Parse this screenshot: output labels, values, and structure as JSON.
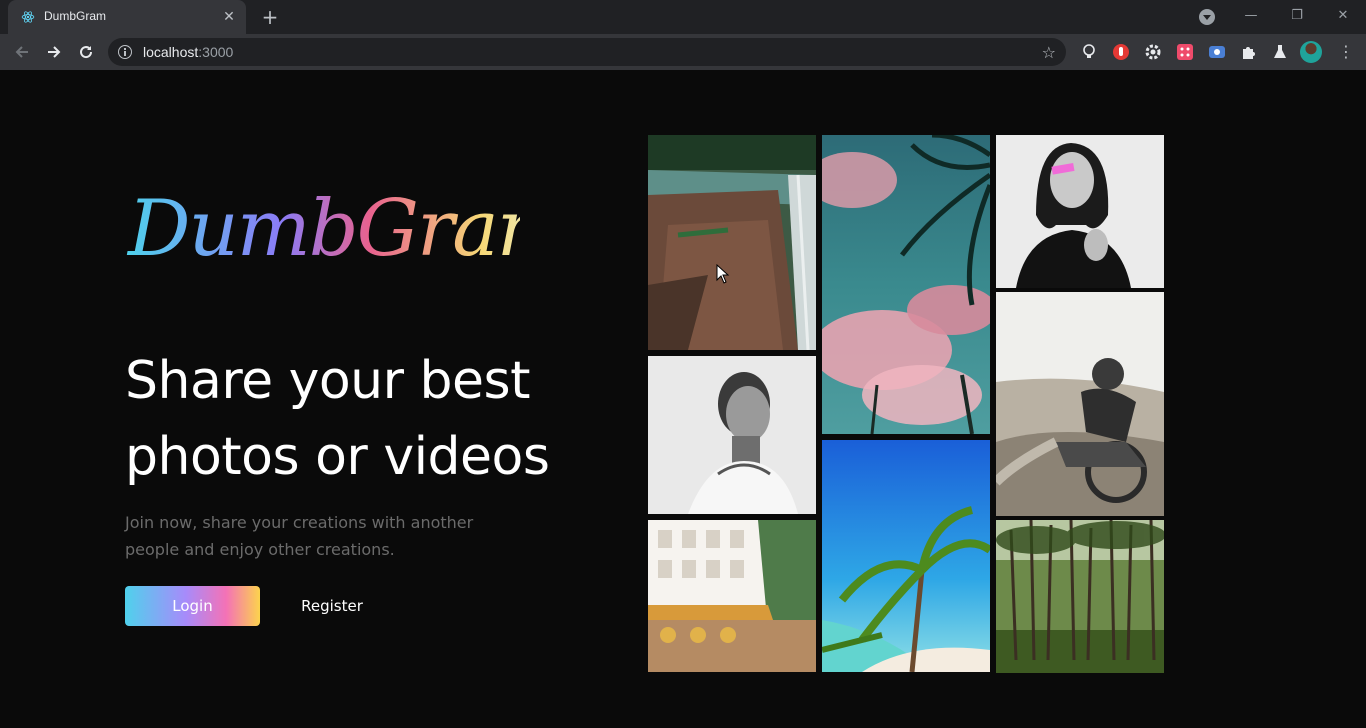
{
  "browser": {
    "tab_title": "DumbGram",
    "tab_close": "✕",
    "new_tab": "+",
    "url_host": "localhost",
    "url_port": ":3000",
    "window_minimize": "—",
    "window_restore": "❐",
    "window_close": "✕"
  },
  "hero": {
    "logo_text": "DumbGram",
    "headline_line1": "Share your best",
    "headline_line2": "photos or videos",
    "subtext": "Join now, share your creations with another people and enjoy other creations.",
    "login_label": "Login",
    "register_label": "Register"
  },
  "gallery": {
    "photos": [
      {
        "name": "waterfall-cliff-photo"
      },
      {
        "name": "palm-trees-pink-sky-photo"
      },
      {
        "name": "woman-black-white-photo"
      },
      {
        "name": "tattooed-man-photo"
      },
      {
        "name": "motorcycle-rider-photo"
      },
      {
        "name": "beach-palm-tree-photo"
      },
      {
        "name": "street-cafe-photo"
      },
      {
        "name": "pine-forest-photo"
      }
    ]
  },
  "colors": {
    "background": "#0a0a0a",
    "brand_gradient": [
      "#4fd1ec",
      "#a78bfa",
      "#f472b6",
      "#fcd34d"
    ]
  }
}
